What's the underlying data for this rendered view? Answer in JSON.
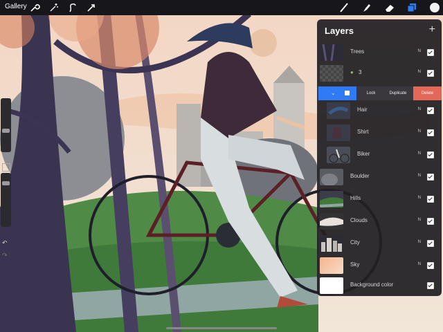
{
  "topbar": {
    "gallery_label": "Gallery",
    "left_icons": [
      "wrench-icon",
      "adjustments-icon",
      "selection-icon",
      "transform-icon"
    ],
    "right_icons": [
      "brush-icon",
      "smudge-icon",
      "eraser-icon",
      "layers-icon",
      "color-swatch-icon"
    ],
    "color_swatch": "#f2f2f2",
    "layers_icon_color": "#2f7bf5"
  },
  "layers_panel": {
    "title": "Layers",
    "add_label": "+",
    "actions": {
      "lock": "Lock",
      "duplicate": "Duplicate",
      "delete": "Delete"
    },
    "accent": "#2f7bf5",
    "delete_color": "#e4685a",
    "layers": [
      {
        "name": "Trees",
        "blend": "N"
      },
      {
        "name": "3",
        "blend": "N"
      },
      {
        "name": "Hair",
        "blend": "N"
      },
      {
        "name": "Shirt",
        "blend": "N"
      },
      {
        "name": "Biker",
        "blend": "N"
      },
      {
        "name": "Boulder",
        "blend": "N"
      },
      {
        "name": "Hills",
        "blend": "N"
      },
      {
        "name": "Clouds",
        "blend": "N"
      },
      {
        "name": "City",
        "blend": "N"
      },
      {
        "name": "Sky",
        "blend": "N"
      },
      {
        "name": "Background color",
        "blend": ""
      }
    ]
  }
}
